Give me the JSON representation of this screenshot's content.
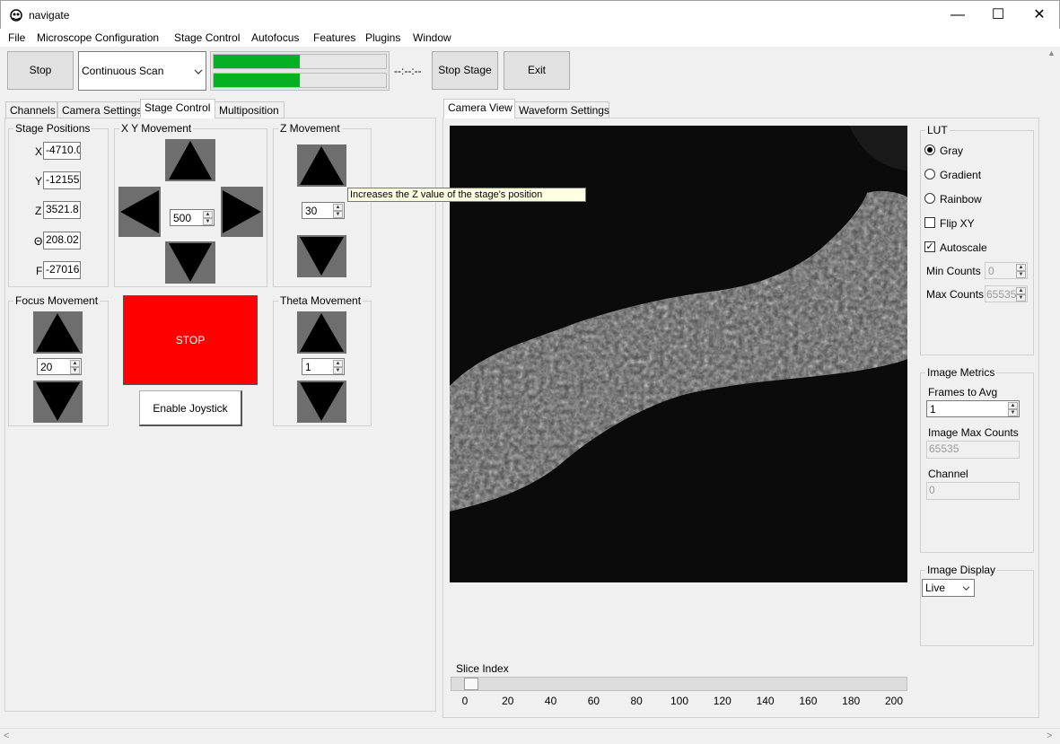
{
  "window": {
    "title": "navigate",
    "minimize": "—",
    "maximize": "☐",
    "close": "✕"
  },
  "menu": [
    "File",
    "Microscope Configuration",
    "Stage Control",
    "Autofocus",
    "Features",
    "Plugins",
    "Window"
  ],
  "toolbar": {
    "stop_label": "Stop",
    "mode_value": "Continuous Scan",
    "progress_top": 0.5,
    "progress_bottom": 0.5,
    "timer": "--:--:--",
    "stop_stage_label": "Stop Stage",
    "exit_label": "Exit"
  },
  "left_tabs": [
    "Channels",
    "Camera Settings",
    "Stage Control",
    "Multiposition"
  ],
  "stage_positions": {
    "title": "Stage Positions",
    "rows": [
      {
        "label": "X",
        "value": "-4710.0"
      },
      {
        "label": "Y",
        "value": "-12155"
      },
      {
        "label": "Z",
        "value": "3521.8"
      },
      {
        "label": "Θ",
        "value": "208.02"
      },
      {
        "label": "F",
        "value": "-27016"
      }
    ]
  },
  "xy_movement": {
    "title": "X Y Movement",
    "step": "500"
  },
  "z_movement": {
    "title": "Z Movement",
    "step": "30"
  },
  "tooltip": "Increases the Z value of the stage's position",
  "focus_movement": {
    "title": "Focus Movement",
    "step": "20"
  },
  "stop_button": "STOP",
  "joystick_button": "Enable Joystick",
  "theta_movement": {
    "title": "Theta Movement",
    "step": "1"
  },
  "right_tabs": [
    "Camera View",
    "Waveform Settings"
  ],
  "lut": {
    "title": "LUT",
    "options": [
      {
        "label": "Gray",
        "type": "radio",
        "checked": true
      },
      {
        "label": "Gradient",
        "type": "radio",
        "checked": false
      },
      {
        "label": "Rainbow",
        "type": "radio",
        "checked": false
      },
      {
        "label": "Flip XY",
        "type": "check",
        "checked": false
      },
      {
        "label": "Autoscale",
        "type": "check",
        "checked": true
      }
    ],
    "min_counts_label": "Min Counts",
    "min_counts_value": "0",
    "max_counts_label": "Max Counts",
    "max_counts_value": "65535"
  },
  "image_metrics": {
    "title": "Image Metrics",
    "frames_label": "Frames to Avg",
    "frames_value": "1",
    "max_counts_label": "Image Max Counts",
    "max_counts_value": "65535",
    "channel_label": "Channel",
    "channel_value": "0"
  },
  "image_display": {
    "title": "Image Display",
    "value": "Live"
  },
  "slice": {
    "label": "Slice Index",
    "ticks": [
      "0",
      "20",
      "40",
      "60",
      "80",
      "100",
      "120",
      "140",
      "160",
      "180",
      "200"
    ],
    "value": 0
  },
  "colors": {
    "progress": "#06b025",
    "stop_red": "#ff0000",
    "tooltip_bg": "#ffffe1"
  }
}
